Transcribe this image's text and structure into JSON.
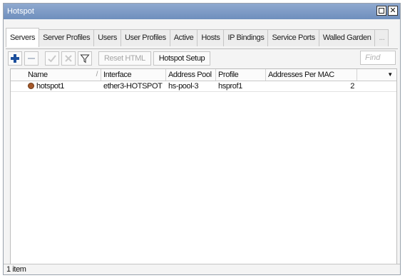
{
  "window": {
    "title": "Hotspot"
  },
  "tabs": [
    {
      "label": "Servers",
      "active": true
    },
    {
      "label": "Server Profiles"
    },
    {
      "label": "Users"
    },
    {
      "label": "User Profiles"
    },
    {
      "label": "Active"
    },
    {
      "label": "Hosts"
    },
    {
      "label": "IP Bindings"
    },
    {
      "label": "Service Ports"
    },
    {
      "label": "Walled Garden"
    },
    {
      "label": "..."
    }
  ],
  "toolbar": {
    "icons": [
      "add-icon",
      "remove-icon",
      "enable-icon",
      "disable-icon",
      "filter-icon"
    ],
    "reset_html_label": "Reset HTML",
    "hotspot_setup_label": "Hotspot Setup",
    "find_placeholder": "Find"
  },
  "table": {
    "columns": [
      "Name",
      "Interface",
      "Address Pool",
      "Profile",
      "Addresses Per MAC"
    ],
    "sort_mark": "/",
    "column_menu_icon": "▼",
    "rows": [
      {
        "name": "hotspot1",
        "interface": "ether3-HOTSPOT",
        "address_pool": "hs-pool-3",
        "profile": "hsprof1",
        "addresses_per_mac": "2"
      }
    ]
  },
  "status": {
    "text": "1 item"
  },
  "colors": {
    "titlebar": "#7f9cc7",
    "add": "#1c4f9c",
    "hotspot_icon": "#a5582a"
  }
}
